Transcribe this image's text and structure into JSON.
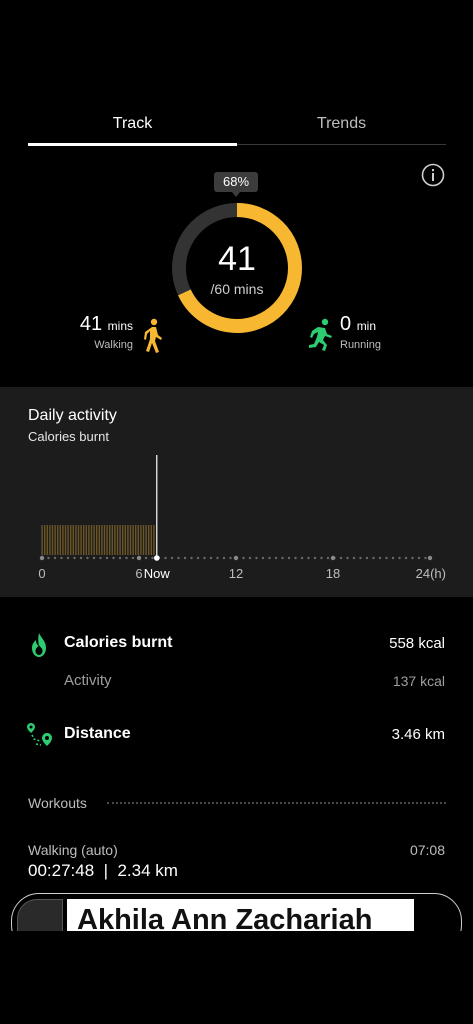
{
  "tabs": [
    {
      "label": "Track",
      "selected": true
    },
    {
      "label": "Trends",
      "selected": false
    }
  ],
  "goal": {
    "percent_label": "68%",
    "progress": 0.68,
    "value": "41",
    "target": "/60 mins",
    "accent_color": "#F7B731",
    "track_color": "#333333"
  },
  "walking": {
    "value": "41",
    "unit": "mins",
    "label": "Walking",
    "icon": "walking-person-icon",
    "color": "#F7B731"
  },
  "running": {
    "value": "0",
    "unit": "min",
    "label": "Running",
    "icon": "running-person-icon",
    "color": "#2ECC71"
  },
  "daily_activity": {
    "title": "Daily activity",
    "subtitle": "Calories burnt",
    "axis_labels": [
      "0",
      "6",
      "Now",
      "12",
      "18",
      "24(h)"
    ],
    "axis_hours": [
      0,
      6,
      7.1,
      12,
      18,
      24
    ],
    "bar_fill_until_hour": 7.0,
    "now_hour": 7.1,
    "bar_color": "#6b5527"
  },
  "calories": {
    "title": "Calories burnt",
    "value": "558 kcal",
    "icon": "flame-icon",
    "icon_color": "#2ECC71"
  },
  "activity": {
    "title": "Activity",
    "value": "137 kcal"
  },
  "distance": {
    "title": "Distance",
    "value": "3.46 km",
    "icon": "route-pin-icon",
    "icon_color": "#2ECC71"
  },
  "workouts": {
    "title": "Workouts",
    "items": [
      {
        "name": "Walking (auto)",
        "time": "07:08",
        "stats": "00:27:48  |  2.34 km"
      }
    ]
  },
  "overlay": {
    "text": "Akhila Ann Zachariah"
  }
}
